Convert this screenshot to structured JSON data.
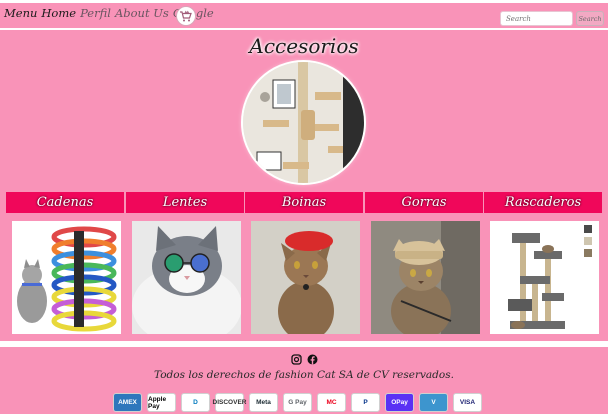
{
  "nav": {
    "links": [
      {
        "label": "Menu",
        "tone": "dark"
      },
      {
        "label": "Home",
        "tone": "dark"
      },
      {
        "label": "Perfil",
        "tone": "light"
      },
      {
        "label": "About Us",
        "tone": "light"
      },
      {
        "label": "Google",
        "tone": "light"
      }
    ],
    "cart_icon": "cart-cat-icon",
    "search_placeholder": "Search",
    "search_button": "Search"
  },
  "main": {
    "title": "Accesorios",
    "hero_image": "cat-wall-shelves-image",
    "categories": [
      {
        "label": "Cadenas",
        "image": "collars-image"
      },
      {
        "label": "Lentes",
        "image": "cat-sunglasses-image"
      },
      {
        "label": "Boinas",
        "image": "cat-beret-image"
      },
      {
        "label": "Gorras",
        "image": "cat-cap-image"
      },
      {
        "label": "Rascaderos",
        "image": "cat-tree-image"
      }
    ]
  },
  "footer": {
    "social_icons": [
      "instagram-icon",
      "facebook-icon"
    ],
    "copyright": "Todos los derechos de fashion Cat SA de CV reservados.",
    "payments": [
      {
        "label": "AMEX",
        "bg": "#2e77bc",
        "fg": "#ffffff"
      },
      {
        "label": "Apple Pay",
        "bg": "#ffffff",
        "fg": "#000000"
      },
      {
        "label": "D",
        "bg": "#ffffff",
        "fg": "#0079be"
      },
      {
        "label": "DISCOVER",
        "bg": "#ffffff",
        "fg": "#333333"
      },
      {
        "label": "Meta",
        "bg": "#ffffff",
        "fg": "#1c2b33"
      },
      {
        "label": "G Pay",
        "bg": "#ffffff",
        "fg": "#5f6368"
      },
      {
        "label": "MC",
        "bg": "#ffffff",
        "fg": "#eb001b"
      },
      {
        "label": "P",
        "bg": "#ffffff",
        "fg": "#003087"
      },
      {
        "label": "OPay",
        "bg": "#5a31f4",
        "fg": "#ffffff"
      },
      {
        "label": "V",
        "bg": "#3d95ce",
        "fg": "#ffffff"
      },
      {
        "label": "VISA",
        "bg": "#ffffff",
        "fg": "#1a1f71"
      }
    ]
  }
}
